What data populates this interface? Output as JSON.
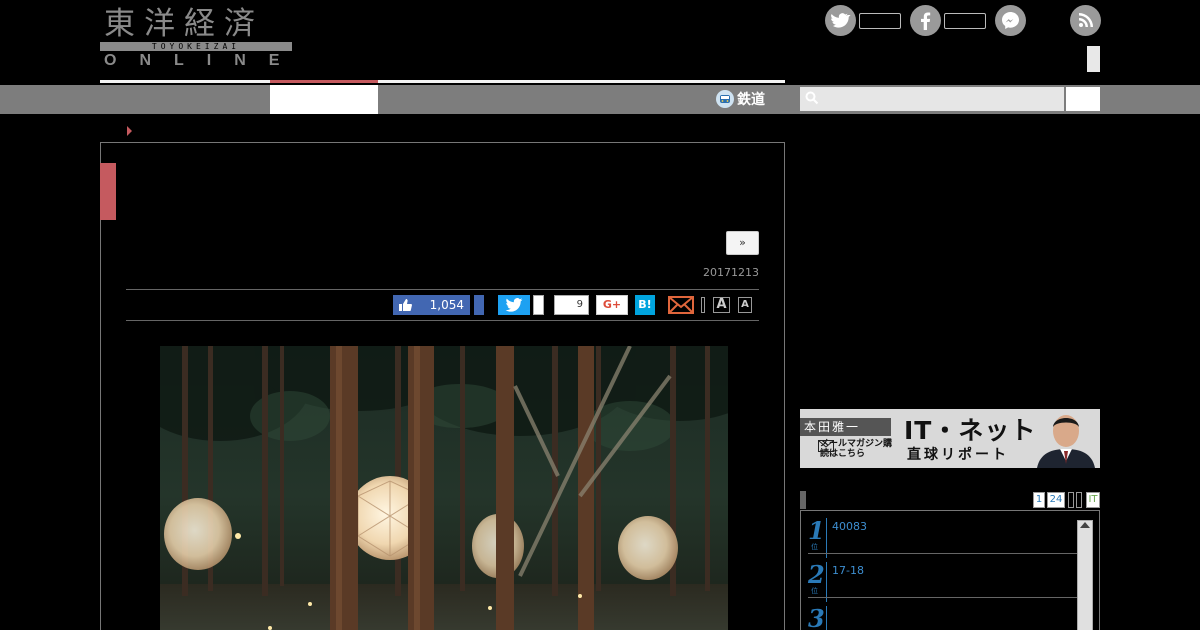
{
  "logo": {
    "kanji": "東洋経済",
    "band": "TOYOKEIZAI",
    "online": "ONLINE"
  },
  "header": {
    "social": [
      {
        "name": "twitter",
        "color": "#9a9a9a"
      },
      {
        "name": "facebook",
        "color": "#9a9a9a"
      },
      {
        "name": "messenger",
        "color": "#9a9a9a"
      },
      {
        "name": "rss",
        "color": "#9a9a9a"
      }
    ]
  },
  "nav": {
    "rail_label": "鉄道",
    "accent": "#c55a5f"
  },
  "article": {
    "next_label": "»",
    "date": "20171213",
    "share": {
      "fb_like_count": "1,054",
      "pocket_count": "9",
      "gplus_label": "G+",
      "hatena_label": "B!",
      "font_large": "A",
      "font_small": "A"
    }
  },
  "banner": {
    "name": "本田雅一",
    "mail_text": "メールマガジン購読はこちら",
    "title": "IT・ネット",
    "subtitle": "直球リポート"
  },
  "ranking": {
    "tabs": [
      "1",
      "24"
    ],
    "tab_it": "IT",
    "items": [
      {
        "rank": "1",
        "text": "40083"
      },
      {
        "rank": "2",
        "text": "17-18"
      },
      {
        "rank": "3",
        "text": ""
      }
    ]
  }
}
